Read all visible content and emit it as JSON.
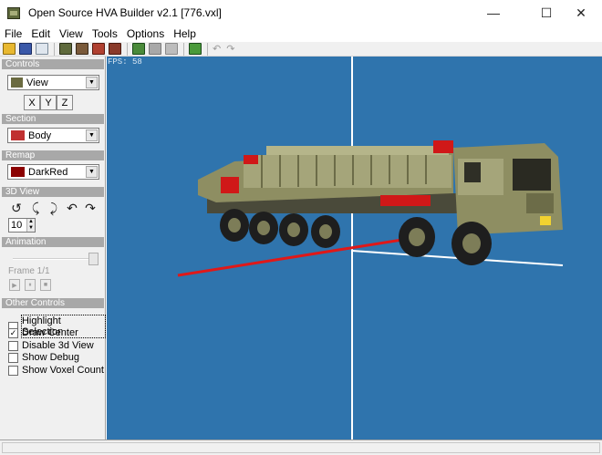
{
  "window": {
    "title": "Open Source HVA Builder v2.1 [776.vxl]"
  },
  "menu": [
    "File",
    "Edit",
    "View",
    "Tools",
    "Options",
    "Help"
  ],
  "toolbar": {
    "buttons": [
      "open-icon",
      "save-icon",
      "save-as-icon",
      "voxel-icon",
      "edit-icon",
      "section-icon",
      "grid-icon",
      "export-icon",
      "disabled-icon",
      "disabled-icon",
      "palette-icon"
    ],
    "undo_glyph": "↶",
    "redo_glyph": "↷"
  },
  "controls": {
    "header": "Controls",
    "mode": "View",
    "axes": [
      "X",
      "Y",
      "Z"
    ]
  },
  "section": {
    "header": "Section",
    "value": "Body"
  },
  "remap": {
    "header": "Remap",
    "value": "DarkRed",
    "color": "#8b0000"
  },
  "view3d": {
    "header": "3D View",
    "rotate_icons": [
      "↺",
      "⤹",
      "⤸",
      "↶",
      "↷"
    ],
    "speed": "10"
  },
  "animation": {
    "header": "Animation",
    "frame_label": "Frame 1/1",
    "controls": [
      "▶",
      "⏸",
      "■"
    ]
  },
  "other_controls": {
    "header": "Other Controls",
    "options": [
      {
        "label": "Highlight Selection",
        "checked": false
      },
      {
        "label": "Draw Center",
        "checked": true
      },
      {
        "label": "Disable 3d View",
        "checked": false
      },
      {
        "label": "Show Debug",
        "checked": false
      },
      {
        "label": "Show Voxel Count",
        "checked": false
      }
    ]
  },
  "viewport": {
    "fps": "FPS: 58",
    "background": "#2f74ad"
  },
  "checkmark": "✓"
}
